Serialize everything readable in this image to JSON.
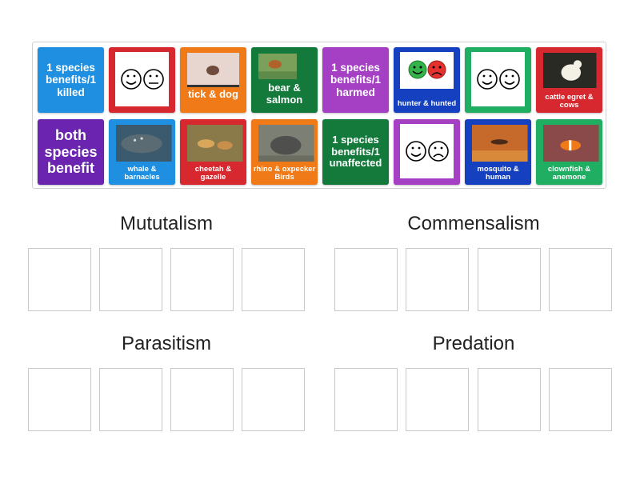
{
  "tiles": {
    "t1": "1 species benefits/1 killed",
    "t2": "",
    "t3": "tick & dog",
    "t4": "bear & salmon",
    "t5": "1 species benefits/1 harmed",
    "t6": "hunter & hunted",
    "t7": "",
    "t8": "cattle egret & cows",
    "t9": "both species benefit",
    "t10": "whale & barnacles",
    "t11": "cheetah & gazelle",
    "t12": "rhino & oxpecker Birds",
    "t13": "1 species benefits/1 unaffected",
    "t14": "",
    "t15": "mosquito & human",
    "t16": "clownfish & anemone"
  },
  "colors": {
    "blue": "#1e8fe1",
    "red": "#d8282f",
    "orange": "#f07a18",
    "green": "#147a3c",
    "magenta": "#a53fc4",
    "navy": "#1541c0",
    "teal": "#1fae62",
    "purple": "#6a24b0"
  },
  "categories": {
    "mutualism": "Mututalism",
    "commensalism": "Commensalism",
    "parasitism": "Parasitism",
    "predation": "Predation"
  },
  "icons": [
    "smiley-face-icon",
    "neutral-face-icon",
    "sad-face-icon"
  ]
}
